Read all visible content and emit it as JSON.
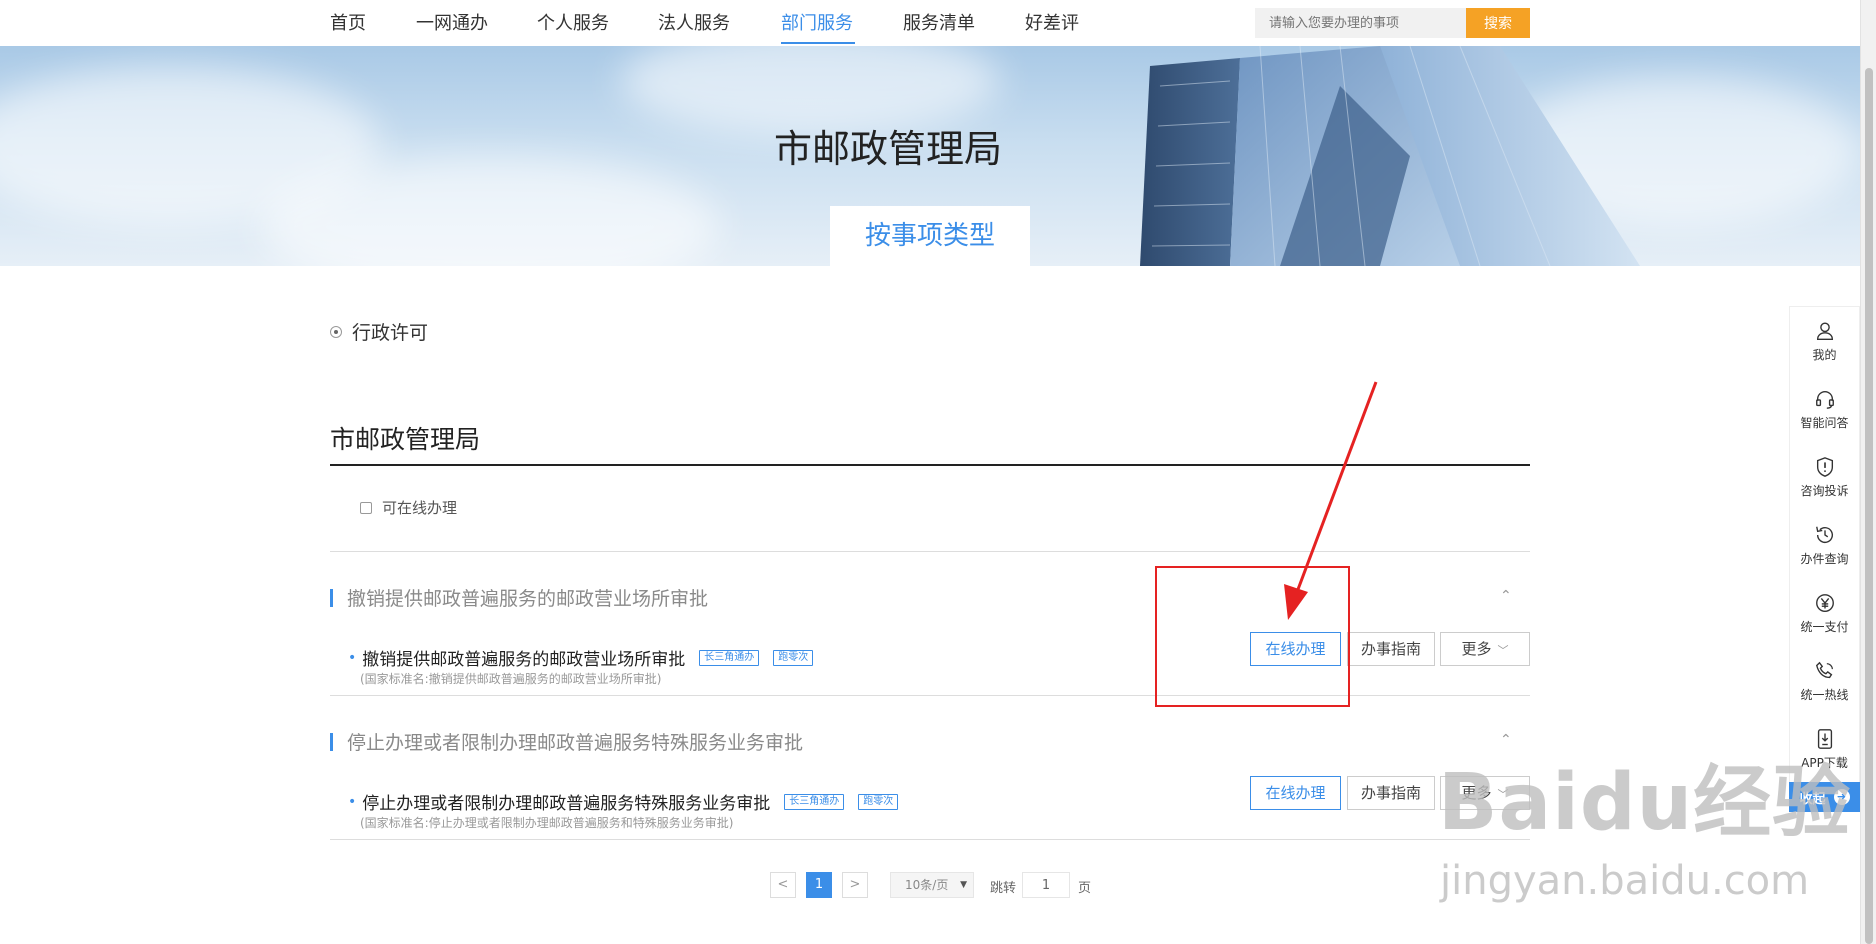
{
  "nav": {
    "items": [
      {
        "label": "首页",
        "active": false
      },
      {
        "label": "一网通办",
        "active": false
      },
      {
        "label": "个人服务",
        "active": false
      },
      {
        "label": "法人服务",
        "active": false
      },
      {
        "label": "部门服务",
        "active": true
      },
      {
        "label": "服务清单",
        "active": false
      },
      {
        "label": "好差评",
        "active": false
      }
    ],
    "search_placeholder": "请输入您要办理的事项",
    "search_button": "搜索"
  },
  "banner": {
    "title": "市邮政管理局",
    "tab_label": "按事项类型"
  },
  "category": {
    "selected": "行政许可"
  },
  "section": {
    "title": "市邮政管理局",
    "online_filter_label": "可在线办理",
    "online_filter_checked": false
  },
  "groups": [
    {
      "title": "撤销提供邮政普遍服务的邮政营业场所审批",
      "item_name": "撤销提供邮政普遍服务的邮政营业场所审批",
      "tags": [
        "长三角通办",
        "跑零次"
      ],
      "std_name": "(国家标准名:撤销提供邮政普遍服务的邮政营业场所审批)",
      "buttons": {
        "online": "在线办理",
        "guide": "办事指南",
        "more": "更多"
      }
    },
    {
      "title": "停止办理或者限制办理邮政普遍服务特殊服务业务审批",
      "item_name": "停止办理或者限制办理邮政普遍服务特殊服务业务审批",
      "tags": [
        "长三角通办",
        "跑零次"
      ],
      "std_name": "(国家标准名:停止办理或者限制办理邮政普遍服务和特殊服务业务审批)",
      "buttons": {
        "online": "在线办理",
        "guide": "办事指南",
        "more": "更多"
      }
    }
  ],
  "pagination": {
    "prev": "<",
    "current": "1",
    "next": ">",
    "page_size": "10条/页",
    "jump_label": "跳转",
    "jump_value": "1",
    "page_suffix": "页"
  },
  "sidebar": {
    "items": [
      {
        "label": "我的",
        "icon": "user-icon"
      },
      {
        "label": "智能问答",
        "icon": "headset-icon"
      },
      {
        "label": "咨询投诉",
        "icon": "alert-shield-icon"
      },
      {
        "label": "办件查询",
        "icon": "history-icon"
      },
      {
        "label": "统一支付",
        "icon": "yuan-icon"
      },
      {
        "label": "统一热线",
        "icon": "phone-icon"
      },
      {
        "label": "APP下载",
        "icon": "download-icon"
      }
    ],
    "collapse_label": "收起",
    "collapse_icon": "➜"
  },
  "watermark": {
    "main": "Baidu经验",
    "sub": "jingyan.baidu.com"
  },
  "colors": {
    "accent": "#3b8ee8",
    "search_button": "#f5a225",
    "annotation": "#e52222"
  }
}
